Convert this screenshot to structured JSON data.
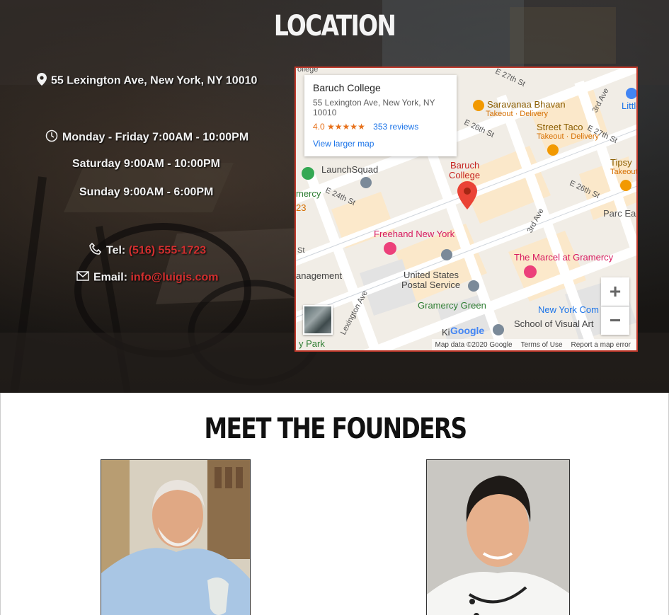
{
  "location": {
    "title": "LOCATION",
    "address": "55 Lexington Ave, New York, NY 10010",
    "hours": [
      "Monday - Friday 7:00AM - 10:00PM",
      "Saturday 9:00AM - 10:00PM",
      "Sunday 9:00AM - 6:00PM"
    ],
    "tel_label": "Tel:",
    "tel_value": "(516) 555-1723",
    "email_label": "Email:",
    "email_value": "info@luigis.com",
    "icons": {
      "address": "map-pin-icon",
      "hours": "clock-icon",
      "tel": "phone-icon",
      "email": "envelope-icon"
    },
    "accent_color": "#d32f2f"
  },
  "map": {
    "card": {
      "name": "Baruch College",
      "address": "55 Lexington Ave, New York, NY 10010",
      "rating": "4.0",
      "stars": "★★★★★",
      "reviews": "353 reviews",
      "larger_map": "View larger map"
    },
    "labels": {
      "college_top": "ollege",
      "e27th": "E 27th St",
      "e27th_right": "E 27th St",
      "e26th": "E 26th St",
      "e26th_right": "E 26th St",
      "e24th": "E 24th St",
      "third_ave": "3rd Ave",
      "third_ave_top": "3rd Ave",
      "lexington": "Lexington Ave",
      "st_left": "St",
      "saravanaa": "Saravanaa Bhavan",
      "saravanaa_sub": "Takeout · Delivery",
      "little": "Little",
      "street_taco": "Street Taco",
      "street_taco_sub": "Takeout · Delivery",
      "tipsy": "Tipsy",
      "tipsy_sub": "Takeout",
      "launchsquad": "LaunchSquad",
      "baruch_pin_1": "Baruch",
      "baruch_pin_2": "College",
      "mercy": "mercy",
      "num23": "23",
      "parc": "Parc Ea",
      "freehand": "Freehand New York",
      "marcel": "The Marcel at Gramercy",
      "management": "anagement",
      "usps_1": "United States",
      "usps_2": "Postal Service",
      "gramercy_green": "Gramercy Green",
      "nyc_com": "New York Com",
      "school_va": "School of Visual Art",
      "kip": "Ki",
      "park": "y Park"
    },
    "zoom_in": "+",
    "zoom_out": "−",
    "google": "Google",
    "attribution": [
      "Map data ©2020 Google",
      "Terms of Use",
      "Report a map error"
    ]
  },
  "founders": {
    "title": "MEET THE FOUNDERS"
  }
}
